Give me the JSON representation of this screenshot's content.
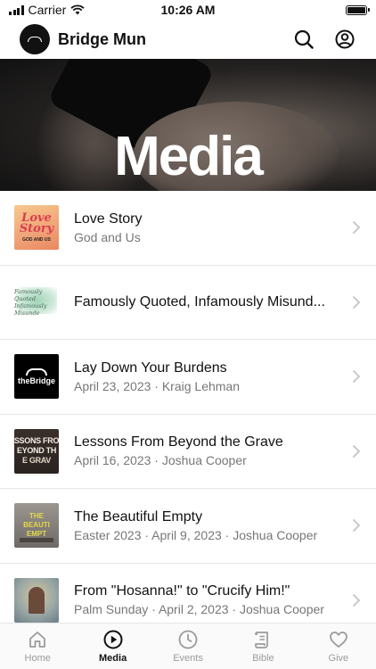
{
  "status_bar": {
    "carrier": "Carrier",
    "time": "10:26 AM"
  },
  "header": {
    "app_name": "Bridge Mun"
  },
  "hero": {
    "title": "Media"
  },
  "media_items": [
    {
      "title": "Love Story",
      "subtitle": "God and Us",
      "thumb_text": [
        "Love",
        "Story",
        "GOD AND US"
      ]
    },
    {
      "title": "Famously Quoted, Infamously Misund...",
      "subtitle": "",
      "thumb_text": [
        "Famously Quoted",
        "Infamously Misunde"
      ]
    },
    {
      "title": "Lay Down Your Burdens",
      "subtitle": "April 23, 2023 · Kraig Lehman",
      "thumb_text": [
        "theBridge"
      ]
    },
    {
      "title": "Lessons From Beyond the Grave",
      "subtitle": "April 16, 2023 · Joshua Cooper",
      "thumb_text": [
        "SSONS FRO",
        "EYOND TH",
        "E GRAV"
      ]
    },
    {
      "title": "The Beautiful Empty",
      "subtitle": "Easter 2023 · April 9, 2023 · Joshua Cooper",
      "thumb_text": [
        "THE",
        "BEAUTI",
        "EMPT"
      ]
    },
    {
      "title": "From \"Hosanna!\" to \"Crucify Him!\"",
      "subtitle": "Palm Sunday · April 2, 2023 · Joshua Cooper",
      "thumb_text": []
    }
  ],
  "tabs": [
    {
      "label": "Home",
      "icon": "home-icon",
      "active": false
    },
    {
      "label": "Media",
      "icon": "play-circle-icon",
      "active": true
    },
    {
      "label": "Events",
      "icon": "clock-icon",
      "active": false
    },
    {
      "label": "Bible",
      "icon": "scroll-icon",
      "active": false
    },
    {
      "label": "Give",
      "icon": "heart-icon",
      "active": false
    }
  ],
  "colors": {
    "active_tab": "#111111",
    "inactive_tab": "#9a9a9a",
    "subtitle": "#777777",
    "divider": "#e6e6e6"
  }
}
